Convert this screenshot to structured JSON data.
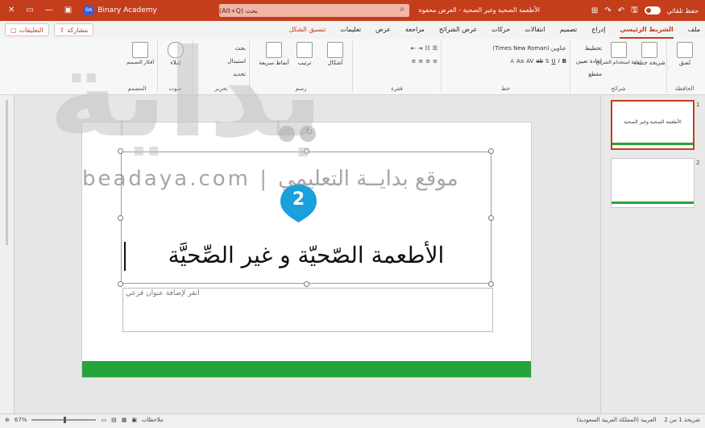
{
  "titlebar": {
    "close_glyph": "✕",
    "user_name": "Binary Academy",
    "user_initials": "BA",
    "search_text": "بحث (Alt+Q)",
    "document_title": "الأطعمة الصحية وغير الصحية - العرض محفوظ",
    "autosave_label": "حفظ تلقائي",
    "toggle_label": "تشغيل"
  },
  "tabs": [
    {
      "label": "ملف",
      "active": false
    },
    {
      "label": "الشريط الرئيسي",
      "active": true
    },
    {
      "label": "إدراج",
      "active": false
    },
    {
      "label": "تصميم",
      "active": false
    },
    {
      "label": "انتقالات",
      "active": false
    },
    {
      "label": "حركات",
      "active": false
    },
    {
      "label": "عرض الشرائح",
      "active": false
    },
    {
      "label": "مراجعة",
      "active": false
    },
    {
      "label": "عرض",
      "active": false
    },
    {
      "label": "تعليمات",
      "active": false
    },
    {
      "label": "تنسيق الشكل",
      "active": false,
      "shape": true
    }
  ],
  "tabs_left": {
    "comments": "التعليقات",
    "share": "مشاركة"
  },
  "ribbon": {
    "groups": {
      "clipboard": "الحافظة",
      "slides": "شرائح",
      "font": "خط",
      "paragraph": "فقرة",
      "drawing": "رسم",
      "editing": "تحرير",
      "voice": "صوت",
      "designer": "المصمم"
    },
    "clipboard": {
      "paste": "لصق"
    },
    "slides": {
      "new_slide": "شريحة جديدة",
      "reuse": "إعادة استخدام الشرائح",
      "layout": "تخطيط",
      "reset": "إعادة تعيين",
      "section": "مقطع"
    },
    "font": {
      "font_name": "عناوين (Times New Roman)",
      "font_size": "A"
    },
    "drawing": {
      "shapes": "أشكال",
      "arrange": "ترتيب",
      "styles": "أنماط سريعة"
    },
    "editing": {
      "find": "بحث",
      "replace": "استبدال",
      "select": "تحديد"
    },
    "voice": {
      "dictate": "إملاء"
    },
    "designer": {
      "ideas": "أفكار التصميم"
    }
  },
  "slide": {
    "title": "الأطعمة الصّحيّة و غير الصِّحيَّة",
    "subtitle_placeholder": "انقر لإضافة عنوان فرعي"
  },
  "badge": {
    "number": "2",
    "color": "#1aa0dc"
  },
  "watermark": {
    "logo": "بداية",
    "line": "beadaya.com | موقع بدايــة التعليمي"
  },
  "thumbnails": [
    {
      "number": "1",
      "text": "الأطعمة الصحية وغير الصحية",
      "selected": true
    },
    {
      "number": "2",
      "text": "",
      "selected": false
    }
  ],
  "statusbar": {
    "zoom": "67%",
    "notes": "ملاحظات",
    "slide_position": "شريحة 1 من 2",
    "language": "العربية (المملكة العربية السعودية)"
  },
  "colors": {
    "accent": "#c43e1c",
    "green": "#26a33a",
    "badge": "#1aa0dc"
  }
}
